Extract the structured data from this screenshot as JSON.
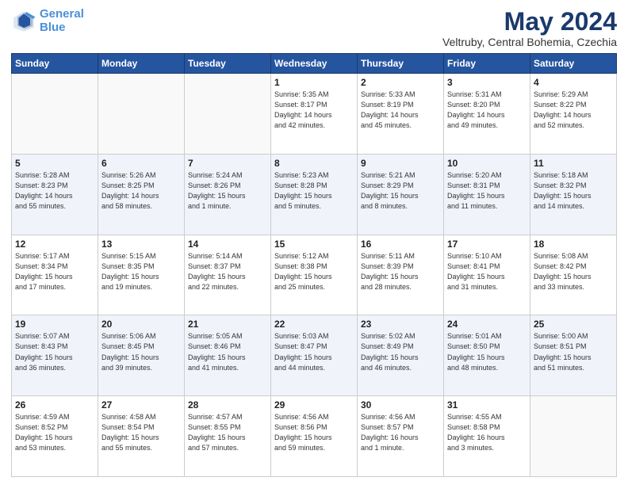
{
  "header": {
    "logo_line1": "General",
    "logo_line2": "Blue",
    "main_title": "May 2024",
    "subtitle": "Veltruby, Central Bohemia, Czechia"
  },
  "weekdays": [
    "Sunday",
    "Monday",
    "Tuesday",
    "Wednesday",
    "Thursday",
    "Friday",
    "Saturday"
  ],
  "weeks": [
    [
      {
        "day": "",
        "info": ""
      },
      {
        "day": "",
        "info": ""
      },
      {
        "day": "",
        "info": ""
      },
      {
        "day": "1",
        "info": "Sunrise: 5:35 AM\nSunset: 8:17 PM\nDaylight: 14 hours\nand 42 minutes."
      },
      {
        "day": "2",
        "info": "Sunrise: 5:33 AM\nSunset: 8:19 PM\nDaylight: 14 hours\nand 45 minutes."
      },
      {
        "day": "3",
        "info": "Sunrise: 5:31 AM\nSunset: 8:20 PM\nDaylight: 14 hours\nand 49 minutes."
      },
      {
        "day": "4",
        "info": "Sunrise: 5:29 AM\nSunset: 8:22 PM\nDaylight: 14 hours\nand 52 minutes."
      }
    ],
    [
      {
        "day": "5",
        "info": "Sunrise: 5:28 AM\nSunset: 8:23 PM\nDaylight: 14 hours\nand 55 minutes."
      },
      {
        "day": "6",
        "info": "Sunrise: 5:26 AM\nSunset: 8:25 PM\nDaylight: 14 hours\nand 58 minutes."
      },
      {
        "day": "7",
        "info": "Sunrise: 5:24 AM\nSunset: 8:26 PM\nDaylight: 15 hours\nand 1 minute."
      },
      {
        "day": "8",
        "info": "Sunrise: 5:23 AM\nSunset: 8:28 PM\nDaylight: 15 hours\nand 5 minutes."
      },
      {
        "day": "9",
        "info": "Sunrise: 5:21 AM\nSunset: 8:29 PM\nDaylight: 15 hours\nand 8 minutes."
      },
      {
        "day": "10",
        "info": "Sunrise: 5:20 AM\nSunset: 8:31 PM\nDaylight: 15 hours\nand 11 minutes."
      },
      {
        "day": "11",
        "info": "Sunrise: 5:18 AM\nSunset: 8:32 PM\nDaylight: 15 hours\nand 14 minutes."
      }
    ],
    [
      {
        "day": "12",
        "info": "Sunrise: 5:17 AM\nSunset: 8:34 PM\nDaylight: 15 hours\nand 17 minutes."
      },
      {
        "day": "13",
        "info": "Sunrise: 5:15 AM\nSunset: 8:35 PM\nDaylight: 15 hours\nand 19 minutes."
      },
      {
        "day": "14",
        "info": "Sunrise: 5:14 AM\nSunset: 8:37 PM\nDaylight: 15 hours\nand 22 minutes."
      },
      {
        "day": "15",
        "info": "Sunrise: 5:12 AM\nSunset: 8:38 PM\nDaylight: 15 hours\nand 25 minutes."
      },
      {
        "day": "16",
        "info": "Sunrise: 5:11 AM\nSunset: 8:39 PM\nDaylight: 15 hours\nand 28 minutes."
      },
      {
        "day": "17",
        "info": "Sunrise: 5:10 AM\nSunset: 8:41 PM\nDaylight: 15 hours\nand 31 minutes."
      },
      {
        "day": "18",
        "info": "Sunrise: 5:08 AM\nSunset: 8:42 PM\nDaylight: 15 hours\nand 33 minutes."
      }
    ],
    [
      {
        "day": "19",
        "info": "Sunrise: 5:07 AM\nSunset: 8:43 PM\nDaylight: 15 hours\nand 36 minutes."
      },
      {
        "day": "20",
        "info": "Sunrise: 5:06 AM\nSunset: 8:45 PM\nDaylight: 15 hours\nand 39 minutes."
      },
      {
        "day": "21",
        "info": "Sunrise: 5:05 AM\nSunset: 8:46 PM\nDaylight: 15 hours\nand 41 minutes."
      },
      {
        "day": "22",
        "info": "Sunrise: 5:03 AM\nSunset: 8:47 PM\nDaylight: 15 hours\nand 44 minutes."
      },
      {
        "day": "23",
        "info": "Sunrise: 5:02 AM\nSunset: 8:49 PM\nDaylight: 15 hours\nand 46 minutes."
      },
      {
        "day": "24",
        "info": "Sunrise: 5:01 AM\nSunset: 8:50 PM\nDaylight: 15 hours\nand 48 minutes."
      },
      {
        "day": "25",
        "info": "Sunrise: 5:00 AM\nSunset: 8:51 PM\nDaylight: 15 hours\nand 51 minutes."
      }
    ],
    [
      {
        "day": "26",
        "info": "Sunrise: 4:59 AM\nSunset: 8:52 PM\nDaylight: 15 hours\nand 53 minutes."
      },
      {
        "day": "27",
        "info": "Sunrise: 4:58 AM\nSunset: 8:54 PM\nDaylight: 15 hours\nand 55 minutes."
      },
      {
        "day": "28",
        "info": "Sunrise: 4:57 AM\nSunset: 8:55 PM\nDaylight: 15 hours\nand 57 minutes."
      },
      {
        "day": "29",
        "info": "Sunrise: 4:56 AM\nSunset: 8:56 PM\nDaylight: 15 hours\nand 59 minutes."
      },
      {
        "day": "30",
        "info": "Sunrise: 4:56 AM\nSunset: 8:57 PM\nDaylight: 16 hours\nand 1 minute."
      },
      {
        "day": "31",
        "info": "Sunrise: 4:55 AM\nSunset: 8:58 PM\nDaylight: 16 hours\nand 3 minutes."
      },
      {
        "day": "",
        "info": ""
      }
    ]
  ]
}
